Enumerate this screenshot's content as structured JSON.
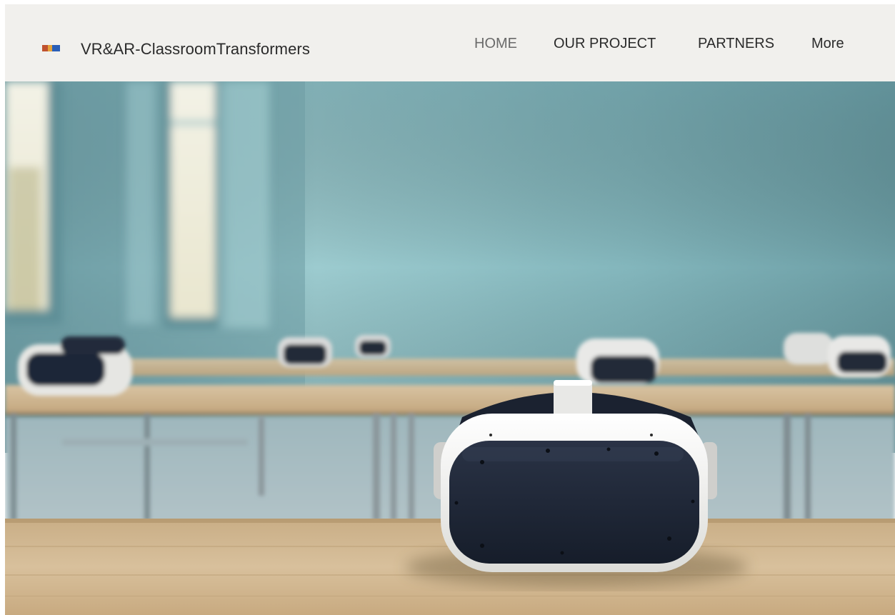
{
  "site": {
    "brand": "VR&AR-ClassroomTransformers",
    "logo_icon": "striped-flag-logo",
    "logo_colors": [
      "#c0522f",
      "#e6a33a",
      "#2a5fb8"
    ]
  },
  "nav": {
    "items": [
      {
        "label": "HOME",
        "active": true
      },
      {
        "label": "OUR PROJECT",
        "active": false
      },
      {
        "label": "PARTNERS",
        "active": false
      },
      {
        "label": "More",
        "active": false
      }
    ]
  },
  "hero": {
    "image_icon": "vr-headset-classroom-photo"
  },
  "colors": {
    "header_bg": "#f1f0ed",
    "wall": "#8fc2c6",
    "table": "#cbb18c",
    "headset_shell": "#f2f2f0",
    "headset_visor": "#1c2433"
  }
}
